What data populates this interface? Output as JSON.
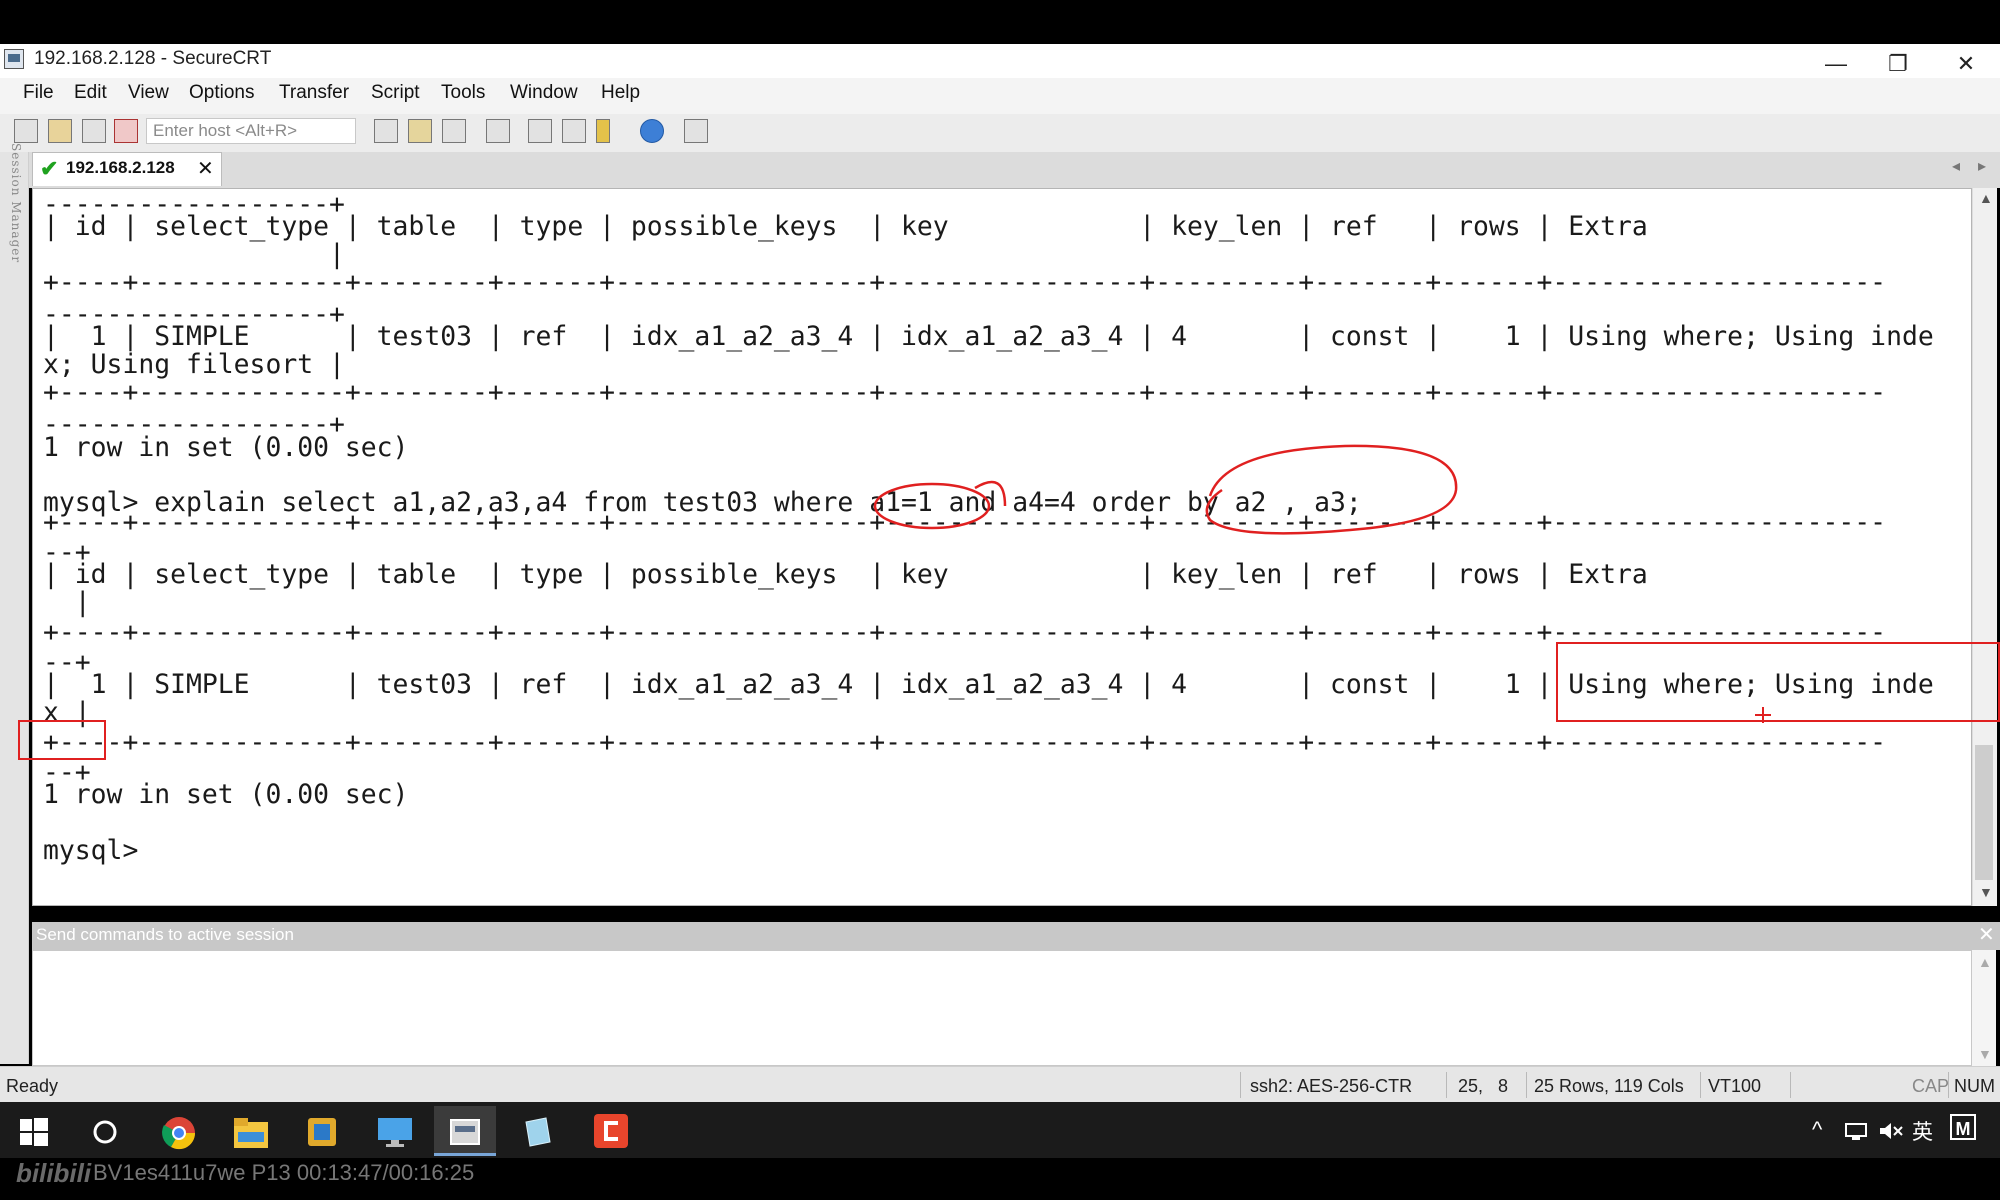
{
  "window": {
    "title": "192.168.2.128 - SecureCRT",
    "minimize": "—",
    "restore": "❐",
    "close": "✕"
  },
  "menu": [
    "File",
    "Edit",
    "View",
    "Options",
    "Transfer",
    "Script",
    "Tools",
    "Window",
    "Help"
  ],
  "toolbar": {
    "host_placeholder": "Enter host <Alt+R>",
    "left_icons": [
      "connect-icon",
      "quick-connect-icon",
      "reconnect-icon",
      "disconnect-icon"
    ],
    "right_icons": [
      "copy-icon",
      "paste-icon",
      "find-icon",
      "print-icon",
      "session-options-icon",
      "global-options-icon",
      "key-icon",
      "help-icon",
      "map-icon"
    ]
  },
  "tab": {
    "label": "192.168.2.128",
    "check": "✔",
    "close": "✕",
    "scroll_left": "◂",
    "scroll_right": "▸"
  },
  "session_manager": "Session Manager",
  "terminal": {
    "lines": [
      "------------------+",
      "| id | select_type | table  | type | possible_keys  | key            | key_len | ref   | rows | Extra",
      "                  |",
      "+----+-------------+--------+------+----------------+----------------+---------+-------+------+---------------------",
      "------------------+",
      "|  1 | SIMPLE      | test03 | ref  | idx_a1_a2_a3_4 | idx_a1_a2_a3_4 | 4       | const |    1 | Using where; Using inde",
      "x; Using filesort |",
      "+----+-------------+--------+------+----------------+----------------+---------+-------+------+---------------------",
      "------------------+",
      "1 row in set (0.00 sec)",
      "",
      "mysql> explain select a1,a2,a3,a4 from test03 where a1=1 and a4=4 order by a2 , a3;",
      "+----+-------------+--------+------+----------------+----------------+---------+-------+------+---------------------",
      "--+",
      "| id | select_type | table  | type | possible_keys  | key            | key_len | ref   | rows | Extra",
      "  |",
      "+----+-------------+--------+------+----------------+----------------+---------+-------+------+---------------------",
      "--+",
      "|  1 | SIMPLE      | test03 | ref  | idx_a1_a2_a3_4 | idx_a1_a2_a3_4 | 4       | const |    1 | Using where; Using inde",
      "x |",
      "+----+-------------+--------+------+----------------+----------------+---------+-------+------+---------------------",
      "--+",
      "1 row in set (0.00 sec)",
      "",
      "mysql>"
    ]
  },
  "send_commands": {
    "label": "Send commands to active session",
    "close": "✕"
  },
  "status": {
    "ready": "Ready",
    "protocol": "ssh2: AES-256-CTR",
    "position": "25,   8",
    "size": "25 Rows, 119 Cols",
    "emulation": "VT100",
    "caps": "CAP",
    "num": "NUM"
  },
  "taskbar": {
    "tray_caret": "^",
    "tray_ime": "英",
    "tray_ime2": "M"
  },
  "video": {
    "logo": "bilibili",
    "info": "BV1es411u7we P13 00:13:47/00:16:25"
  },
  "colors": {
    "annotation": "#e02020",
    "check": "#1fa21f",
    "taskbar": "#1b1b1b"
  }
}
